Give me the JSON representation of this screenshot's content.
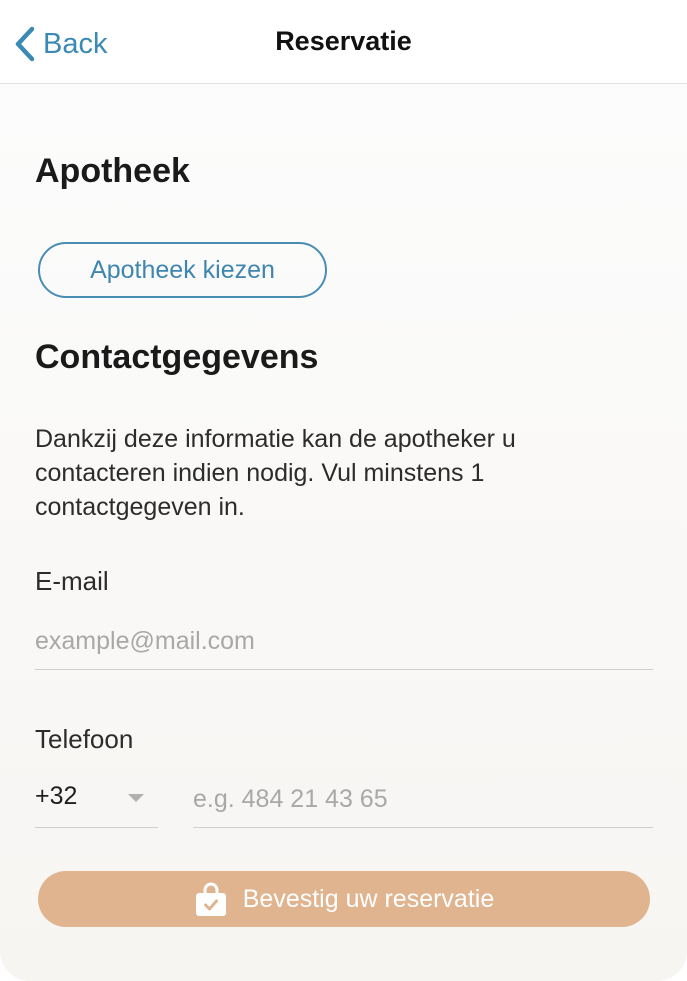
{
  "nav": {
    "back_label": "Back",
    "title": "Reservatie"
  },
  "pharmacy": {
    "heading": "Apotheek",
    "choose_button": "Apotheek kiezen"
  },
  "contact": {
    "heading": "Contactgegevens",
    "description": "Dankzij deze informatie kan de apotheker u contacteren indien nodig. Vul minstens 1 contactgegeven in.",
    "email": {
      "label": "E-mail",
      "value": "",
      "placeholder": "example@mail.com"
    },
    "phone": {
      "label": "Telefoon",
      "country_code": "+32",
      "value": "",
      "placeholder": "e.g. 484 21 43 65"
    }
  },
  "confirm": {
    "label": "Bevestig uw reservatie",
    "icon": "shopping-bag-check-icon"
  },
  "colors": {
    "accent_blue": "#3a8ab4",
    "confirm_button": "#dfb48f"
  }
}
